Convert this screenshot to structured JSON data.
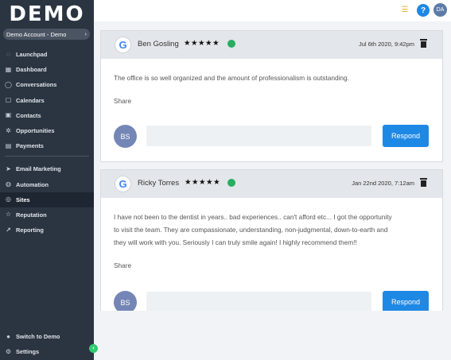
{
  "app": {
    "logo_text": "DEMO",
    "account_label": "Demo Account - Demo",
    "account_chevron": "›"
  },
  "sidebar": {
    "items": [
      {
        "label": "Launchpad",
        "icon": "rocket-icon",
        "glyph": "◌"
      },
      {
        "label": "Dashboard",
        "icon": "dashboard-icon",
        "glyph": "▦"
      },
      {
        "label": "Conversations",
        "icon": "chat-icon",
        "glyph": "◯"
      },
      {
        "label": "Calendars",
        "icon": "calendar-icon",
        "glyph": "▢"
      },
      {
        "label": "Contacts",
        "icon": "contacts-icon",
        "glyph": "▣"
      },
      {
        "label": "Opportunities",
        "icon": "opportunities-icon",
        "glyph": "✲"
      },
      {
        "label": "Payments",
        "icon": "payments-icon",
        "glyph": "▤"
      },
      {
        "label": "Email Marketing",
        "icon": "send-icon",
        "glyph": "➤"
      },
      {
        "label": "Automation",
        "icon": "automation-icon",
        "glyph": "◍"
      },
      {
        "label": "Sites",
        "icon": "globe-icon",
        "glyph": "◎"
      },
      {
        "label": "Reputation",
        "icon": "star-icon",
        "glyph": "☆"
      },
      {
        "label": "Reporting",
        "icon": "chart-icon",
        "glyph": "↗"
      }
    ],
    "bottom": [
      {
        "label": "Switch to Demo",
        "icon": "switch-icon",
        "glyph": "●"
      },
      {
        "label": "Settings",
        "icon": "gear-icon",
        "glyph": "⚙"
      }
    ],
    "active": "Sites",
    "collapse_glyph": "‹"
  },
  "topbar": {
    "list_glyph": "☰",
    "help_glyph": "?",
    "avatar_initials": "DA"
  },
  "reviews": [
    {
      "reviewer": "Ben Gosling",
      "stars": "★★★★★",
      "date": "Jul 6th 2020, 9:42pm",
      "text": [
        "The office is so well organized and the amount of professionalism is outstanding."
      ],
      "share": "Share",
      "reply_avatar": "BS",
      "respond": "Respond",
      "source_icon": "G"
    },
    {
      "reviewer": "Ricky Torres",
      "stars": "★★★★★",
      "date": "Jan 22nd 2020, 7:12am",
      "text": [
        "I have not been to the dentist in years.. bad experiences.. can't afford etc... I got the opportunity",
        "to visit the team. They are compassionate, understanding, non-judgmental, down-to-earth and",
        "they will work with you. Seriously I can truly smile again! I highly recommend them!!"
      ],
      "share": "Share",
      "reply_avatar": "BS",
      "respond": "Respond",
      "source_icon": "G"
    }
  ],
  "colors": {
    "sidebar_bg": "#2b3542",
    "accent": "#1e88e5",
    "positive": "#27ae60"
  }
}
